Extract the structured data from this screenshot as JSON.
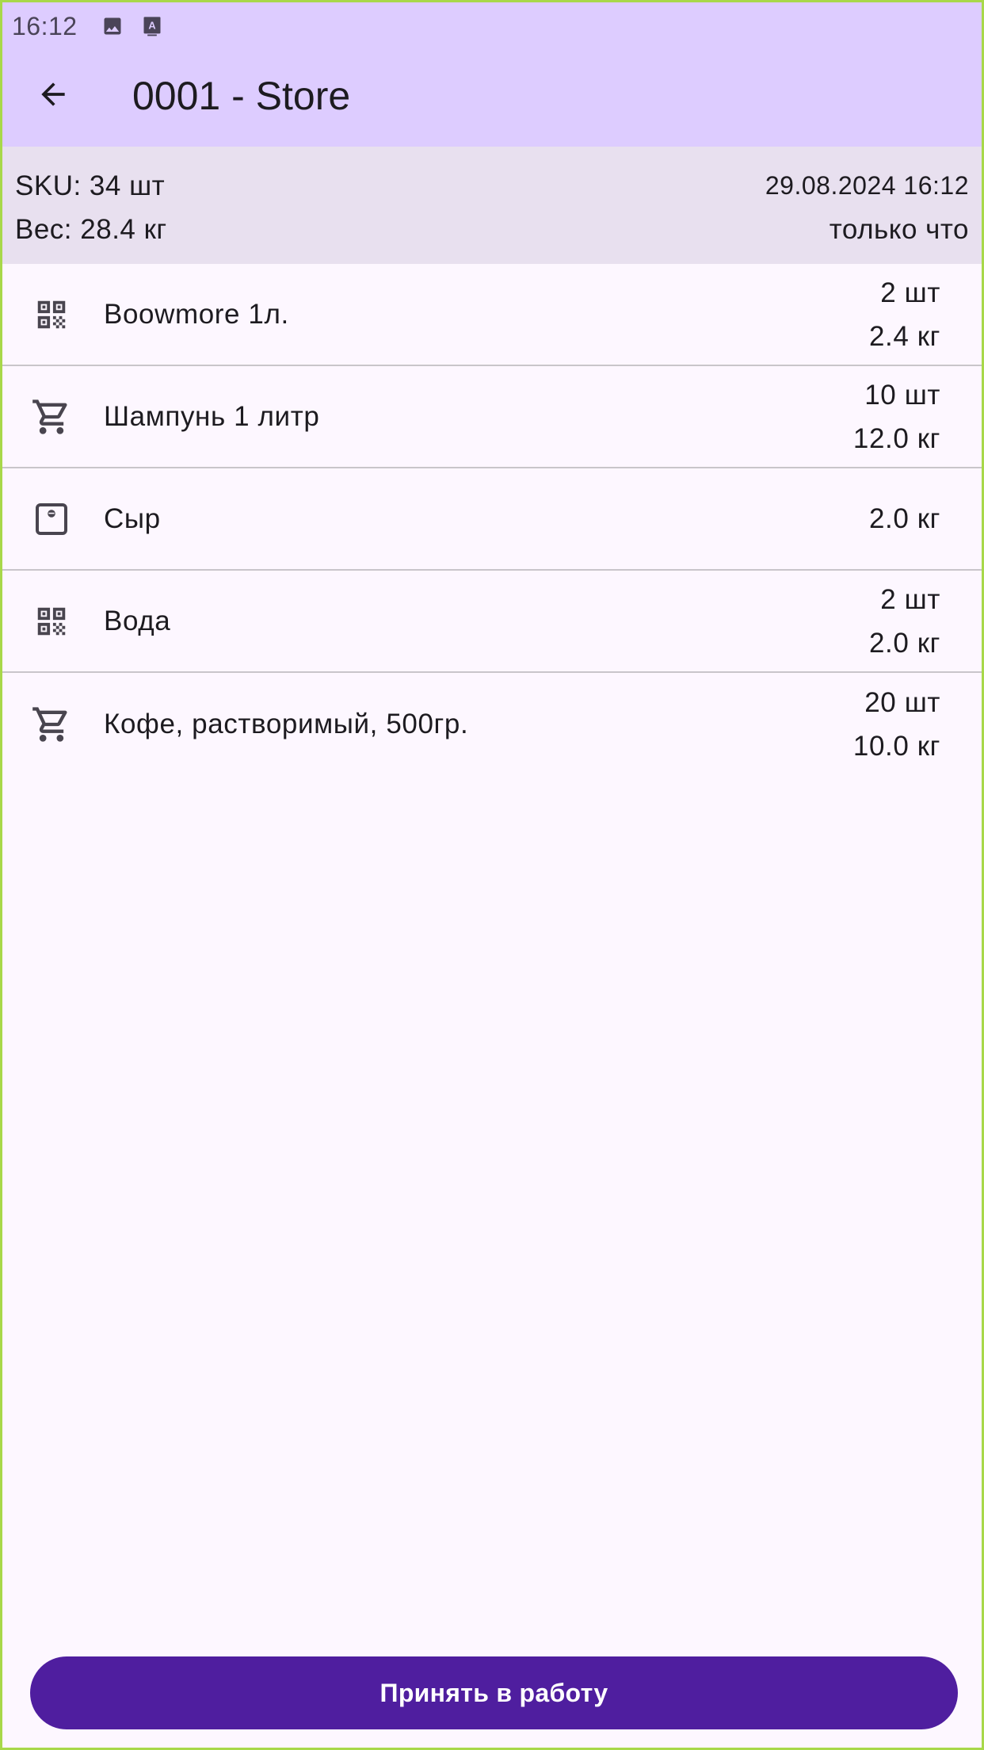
{
  "status_bar": {
    "time": "16:12",
    "icons": [
      "image-icon",
      "keyboard-a-icon"
    ]
  },
  "app_bar": {
    "title": "0001 - Store",
    "back_icon": "arrow-back-icon"
  },
  "summary": {
    "sku": "SKU: 34 шт",
    "weight": "Вес: 28.4 кг",
    "date": "29.08.2024 16:12",
    "relative_time": "только что"
  },
  "items": [
    {
      "icon": "qr-code-icon",
      "name": "Boowmore 1л.",
      "qty": "2 шт",
      "weight": "2.4 кг"
    },
    {
      "icon": "cart-icon",
      "name": "Шампунь 1 литр",
      "qty": "10 шт",
      "weight": "12.0 кг"
    },
    {
      "icon": "scale-icon",
      "name": "Сыр",
      "qty": "",
      "weight": "2.0 кг"
    },
    {
      "icon": "qr-code-icon",
      "name": "Вода",
      "qty": "2 шт",
      "weight": "2.0 кг"
    },
    {
      "icon": "cart-icon",
      "name": "Кофе, растворимый, 500гр.",
      "qty": "20 шт",
      "weight": "10.0 кг"
    }
  ],
  "action": {
    "accept_label": "Принять в работу"
  },
  "colors": {
    "top_bar": "#ddccff",
    "summary_bg": "#e8e0ef",
    "page_bg": "#fdf7ff",
    "button": "#4f1e9f"
  }
}
